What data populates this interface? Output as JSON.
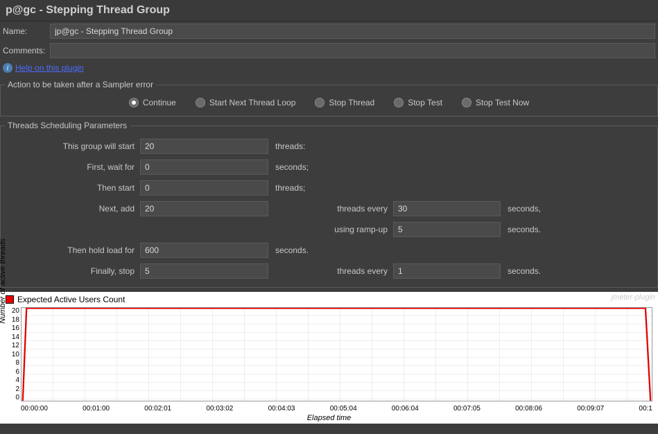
{
  "window": {
    "title": "p@gc - Stepping Thread Group"
  },
  "form": {
    "name_label": "Name:",
    "name_value": "jp@gc - Stepping Thread Group",
    "comments_label": "Comments:",
    "comments_value": ""
  },
  "help": {
    "info_icon": "i",
    "link_text": "Help on this plugin"
  },
  "action_group": {
    "legend": "Action to be taken after a Sampler error",
    "options": [
      {
        "label": "Continue",
        "selected": true
      },
      {
        "label": "Start Next Thread Loop",
        "selected": false
      },
      {
        "label": "Stop Thread",
        "selected": false
      },
      {
        "label": "Stop Test",
        "selected": false
      },
      {
        "label": "Stop Test Now",
        "selected": false
      }
    ]
  },
  "sched": {
    "legend": "Threads Scheduling Parameters",
    "start_label": "This group will start",
    "start_value": "20",
    "start_unit": "threads:",
    "wait_label": "First, wait for",
    "wait_value": "0",
    "wait_unit": "seconds;",
    "then_start_label": "Then start",
    "then_start_value": "0",
    "then_start_unit": "threads;",
    "next_add_label": "Next, add",
    "next_add_value": "20",
    "threads_every_label": "threads every",
    "threads_every_value": "30",
    "seconds_comma": "seconds,",
    "ramp_label": "using ramp-up",
    "ramp_value": "5",
    "seconds_period": "seconds.",
    "hold_label": "Then hold load for",
    "hold_value": "600",
    "hold_unit": "seconds.",
    "finally_label": "Finally, stop",
    "finally_value": "5",
    "finally_every_label": "threads every",
    "finally_every_value": "1",
    "finally_unit": "seconds."
  },
  "chart": {
    "legend_text": "Expected Active Users Count",
    "watermark": "jmeter-plugin",
    "y_label": "Number of active threads",
    "x_label": "Elapsed time"
  },
  "chart_data": {
    "type": "line",
    "title": "",
    "ylabel": "Number of active threads",
    "xlabel": "Elapsed time",
    "ylim": [
      0,
      20
    ],
    "y_ticks": [
      "20",
      "18",
      "16",
      "14",
      "12",
      "10",
      "8",
      "6",
      "4",
      "2",
      "0"
    ],
    "x_ticks": [
      "00:00:00",
      "00:01:00",
      "00:02:01",
      "00:03:02",
      "00:04:03",
      "00:05:04",
      "00:06:04",
      "00:07:05",
      "00:08:06",
      "00:09:07",
      "00:1"
    ],
    "series": [
      {
        "name": "Expected Active Users Count",
        "color": "#e00000",
        "points": [
          {
            "t": "00:00:00",
            "v": 0
          },
          {
            "t": "00:00:05",
            "v": 20
          },
          {
            "t": "00:10:05",
            "v": 20
          },
          {
            "t": "00:10:09",
            "v": 0
          }
        ]
      }
    ]
  }
}
